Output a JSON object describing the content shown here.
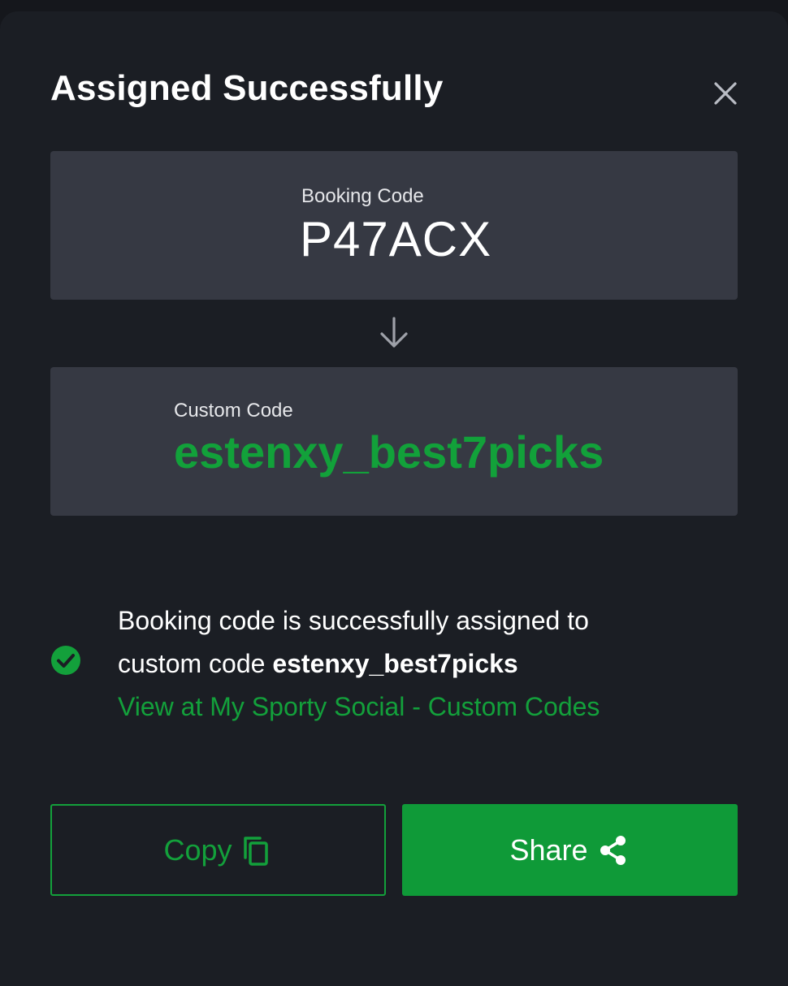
{
  "dialog": {
    "title": "Assigned Successfully",
    "close_icon": "close-icon"
  },
  "booking": {
    "label": "Booking Code",
    "value": "P47ACX"
  },
  "arrow_icon": "arrow-down-icon",
  "custom": {
    "label": "Custom Code",
    "value": "estenxy_best7picks"
  },
  "message": {
    "check_icon": "check-circle-icon",
    "line1": "Booking code is successfully assigned to",
    "line2_prefix": "custom code ",
    "line2_code": "estenxy_best7picks",
    "link": "View at My Sporty Social - Custom Codes"
  },
  "buttons": {
    "copy_label": "Copy",
    "copy_icon": "copy-icon",
    "share_label": "Share",
    "share_icon": "share-icon"
  },
  "colors": {
    "background": "#1b1e24",
    "card": "#363943",
    "accent_green": "#13a03b",
    "text": "#ffffff"
  }
}
